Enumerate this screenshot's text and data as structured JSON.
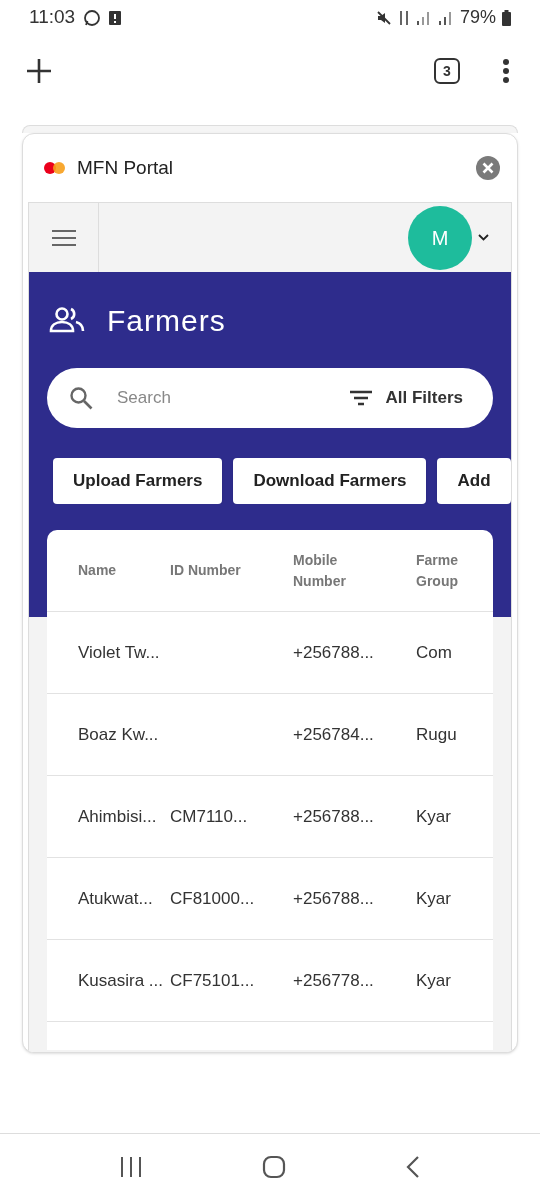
{
  "status_bar": {
    "time": "11:03",
    "battery": "79%"
  },
  "browser": {
    "tab_count": "3"
  },
  "tab_card": {
    "title": "MFN Portal"
  },
  "app_bar": {
    "avatar_letter": "M"
  },
  "page": {
    "title": "Farmers"
  },
  "search": {
    "placeholder": "Search",
    "filter_label": "All Filters"
  },
  "actions": [
    "Upload Farmers",
    "Download Farmers",
    "Add"
  ],
  "table": {
    "columns": [
      "Name",
      "ID Number",
      "Mobile Number",
      "Farme Group"
    ],
    "rows": [
      [
        "Violet Tw...",
        "",
        "+256788...",
        "Com"
      ],
      [
        "Boaz Kw...",
        "",
        "+256784...",
        "Rugu"
      ],
      [
        "Ahimbisi...",
        "CM7110...",
        "+256788...",
        "Kyar"
      ],
      [
        "Atukwat...",
        "CF81000...",
        "+256788...",
        "Kyar"
      ],
      [
        "Kusasira ...",
        "CF75101...",
        "+256778...",
        "Kyar"
      ]
    ]
  }
}
